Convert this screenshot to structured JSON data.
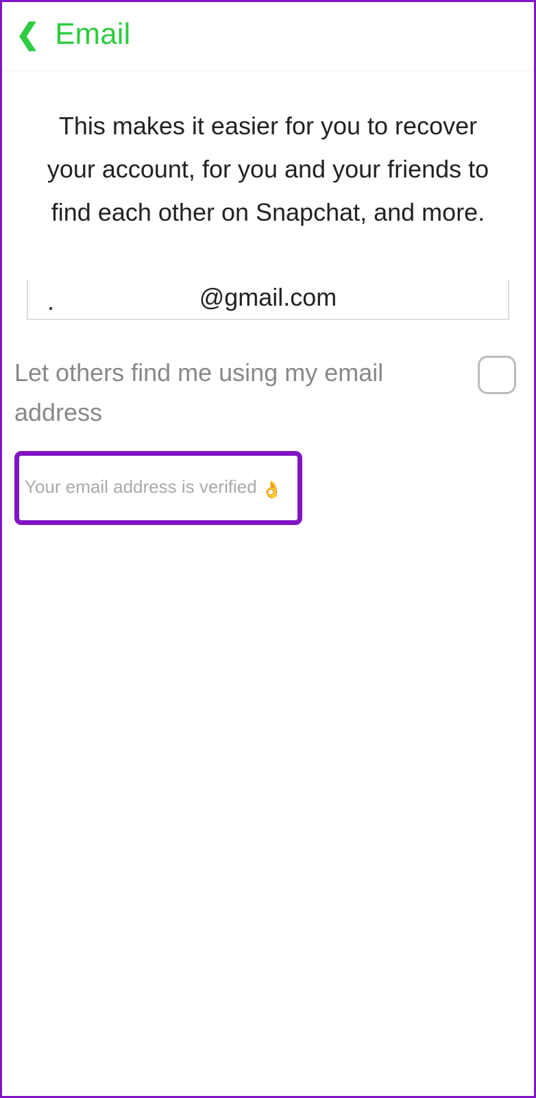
{
  "header": {
    "title": "Email"
  },
  "description": "This makes it easier for you to recover your account, for you and your friends to find each other on Snapchat, and more.",
  "email": {
    "value": "@gmail.com",
    "dot": "."
  },
  "checkbox": {
    "label": "Let others find me using my email address",
    "checked": false
  },
  "verified": {
    "text": "Your email address is verified ",
    "emoji": "👌"
  }
}
